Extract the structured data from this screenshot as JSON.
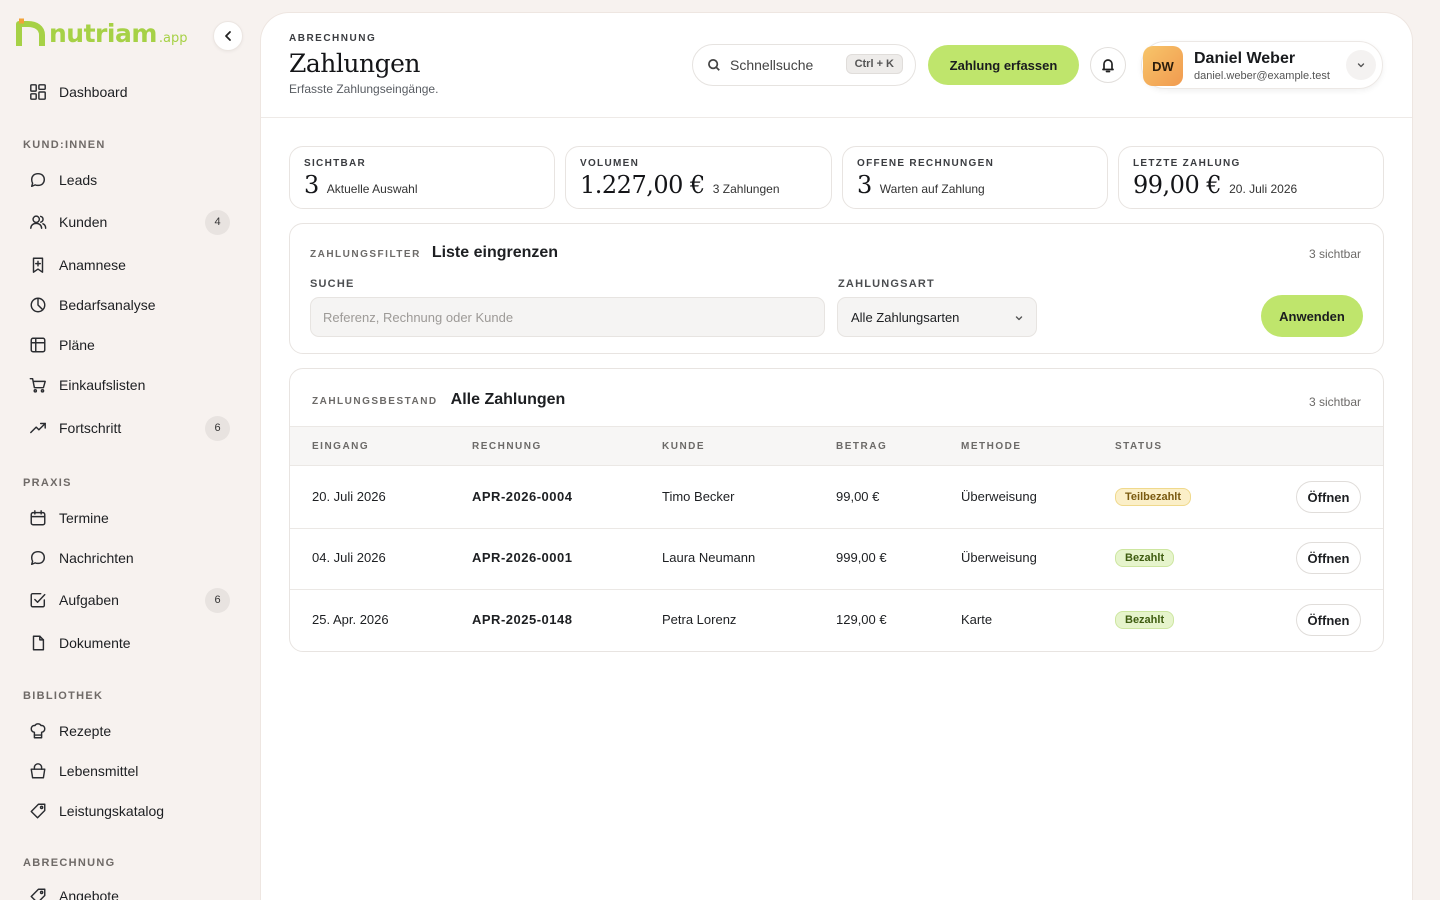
{
  "brand": {
    "name": "nutriam",
    "suffix": ".app"
  },
  "sidebar": {
    "dashboard": "Dashboard",
    "sections": [
      {
        "title": "KUND:INNEN",
        "items": [
          {
            "label": "Leads",
            "icon": "chat-bubble-icon",
            "badge": ""
          },
          {
            "label": "Kunden",
            "icon": "users-icon",
            "badge": "4"
          },
          {
            "label": "Anamnese",
            "icon": "bookmark-plus-icon",
            "badge": ""
          },
          {
            "label": "Bedarfsanalyse",
            "icon": "clock-icon",
            "badge": ""
          },
          {
            "label": "Pläne",
            "icon": "table-icon",
            "badge": ""
          },
          {
            "label": "Einkaufslisten",
            "icon": "cart-icon",
            "badge": ""
          },
          {
            "label": "Fortschritt",
            "icon": "trend-icon",
            "badge": "6"
          }
        ]
      },
      {
        "title": "PRAXIS",
        "items": [
          {
            "label": "Termine",
            "icon": "calendar-icon",
            "badge": ""
          },
          {
            "label": "Nachrichten",
            "icon": "message-icon",
            "badge": ""
          },
          {
            "label": "Aufgaben",
            "icon": "checkbox-icon",
            "badge": "6"
          },
          {
            "label": "Dokumente",
            "icon": "document-icon",
            "badge": ""
          }
        ]
      },
      {
        "title": "BIBLIOTHEK",
        "items": [
          {
            "label": "Rezepte",
            "icon": "chef-hat-icon",
            "badge": ""
          },
          {
            "label": "Lebensmittel",
            "icon": "basket-icon",
            "badge": ""
          },
          {
            "label": "Leistungskatalog",
            "icon": "tag-icon",
            "badge": ""
          }
        ]
      },
      {
        "title": "ABRECHNUNG",
        "items": [
          {
            "label": "Angebote",
            "icon": "tag-icon",
            "badge": ""
          }
        ]
      }
    ]
  },
  "header": {
    "eyebrow": "ABRECHNUNG",
    "title": "Zahlungen",
    "subtitle": "Erfasste Zahlungseingänge.",
    "search_label": "Schnellsuche",
    "search_shortcut": "Ctrl + K",
    "primary_action": "Zahlung erfassen",
    "user": {
      "initials": "DW",
      "name": "Daniel Weber",
      "email": "daniel.weber@example.test"
    }
  },
  "stats": [
    {
      "eyebrow": "SICHTBAR",
      "value": "3",
      "sub": "Aktuelle Auswahl"
    },
    {
      "eyebrow": "VOLUMEN",
      "value": "1.227,00 €",
      "sub": "3 Zahlungen"
    },
    {
      "eyebrow": "OFFENE RECHNUNGEN",
      "value": "3",
      "sub": "Warten auf Zahlung"
    },
    {
      "eyebrow": "LETZTE ZAHLUNG",
      "value": "99,00 €",
      "sub": "20. Juli 2026"
    }
  ],
  "filter": {
    "eyebrow": "ZAHLUNGSFILTER",
    "title": "Liste eingrenzen",
    "count": "3 sichtbar",
    "search_label": "SUCHE",
    "search_placeholder": "Referenz, Rechnung oder Kunde",
    "type_label": "ZAHLUNGSART",
    "type_value": "Alle Zahlungsarten",
    "apply": "Anwenden"
  },
  "payments": {
    "eyebrow": "ZAHLUNGSBESTAND",
    "title": "Alle Zahlungen",
    "count": "3 sichtbar",
    "columns": [
      "EINGANG",
      "RECHNUNG",
      "KUNDE",
      "BETRAG",
      "METHODE",
      "STATUS"
    ],
    "open_label": "Öffnen",
    "rows": [
      {
        "date": "20. Juli 2026",
        "invoice": "APR-2026-0004",
        "customer": "Timo Becker",
        "amount": "99,00 €",
        "method": "Überweisung",
        "status": "Teilbezahlt",
        "status_kind": "partial"
      },
      {
        "date": "04. Juli 2026",
        "invoice": "APR-2026-0001",
        "customer": "Laura Neumann",
        "amount": "999,00 €",
        "method": "Überweisung",
        "status": "Bezahlt",
        "status_kind": "paid"
      },
      {
        "date": "25. Apr. 2026",
        "invoice": "APR-2025-0148",
        "customer": "Petra Lorenz",
        "amount": "129,00 €",
        "method": "Karte",
        "status": "Bezahlt",
        "status_kind": "paid"
      }
    ]
  },
  "colors": {
    "accent": "#bfe56c",
    "brand": "#a6d146",
    "partial_bg": "#fbefc8",
    "paid_bg": "#e6f4cc"
  }
}
